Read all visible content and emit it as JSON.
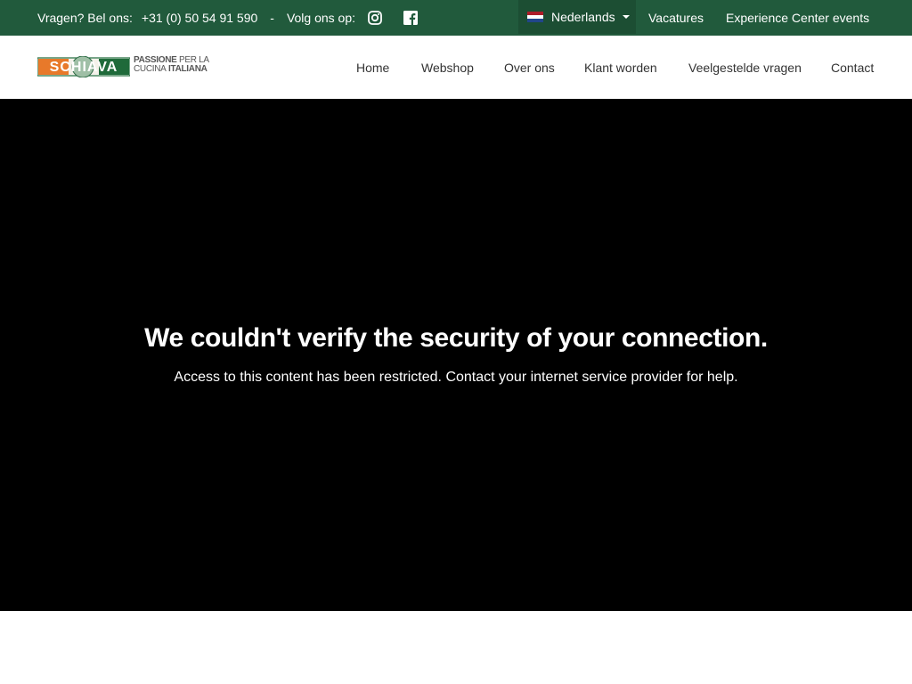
{
  "topbar": {
    "question_label": "Vragen? Bel ons:",
    "phone": "+31 (0) 50 54 91 590",
    "separator": "-",
    "follow_label": "Volg ons op:",
    "language": "Nederlands",
    "links": [
      "Vacatures",
      "Experience Center events"
    ],
    "colors": {
      "background": "#215a3c",
      "language_background": "#1c4e33",
      "text": "#ffffff"
    }
  },
  "logo": {
    "brand": "SCHIAVA",
    "tagline_line1_bold": "PASSIONE",
    "tagline_line1_thin": "PER LA",
    "tagline_line2_thin": "CUCINA",
    "tagline_line2_bold": "ITALIANA"
  },
  "nav": {
    "items": [
      "Home",
      "Webshop",
      "Over ons",
      "Klant worden",
      "Veelgestelde vragen",
      "Contact"
    ]
  },
  "hero": {
    "title": "We couldn't verify the security of your connection.",
    "message": "Access to this content has been restricted. Contact your internet service provider for help.",
    "background": "#000000"
  },
  "icons": {
    "instagram": "instagram-icon",
    "facebook": "facebook-icon",
    "flag": "netherlands-flag-icon",
    "caret": "chevron-down-icon"
  }
}
